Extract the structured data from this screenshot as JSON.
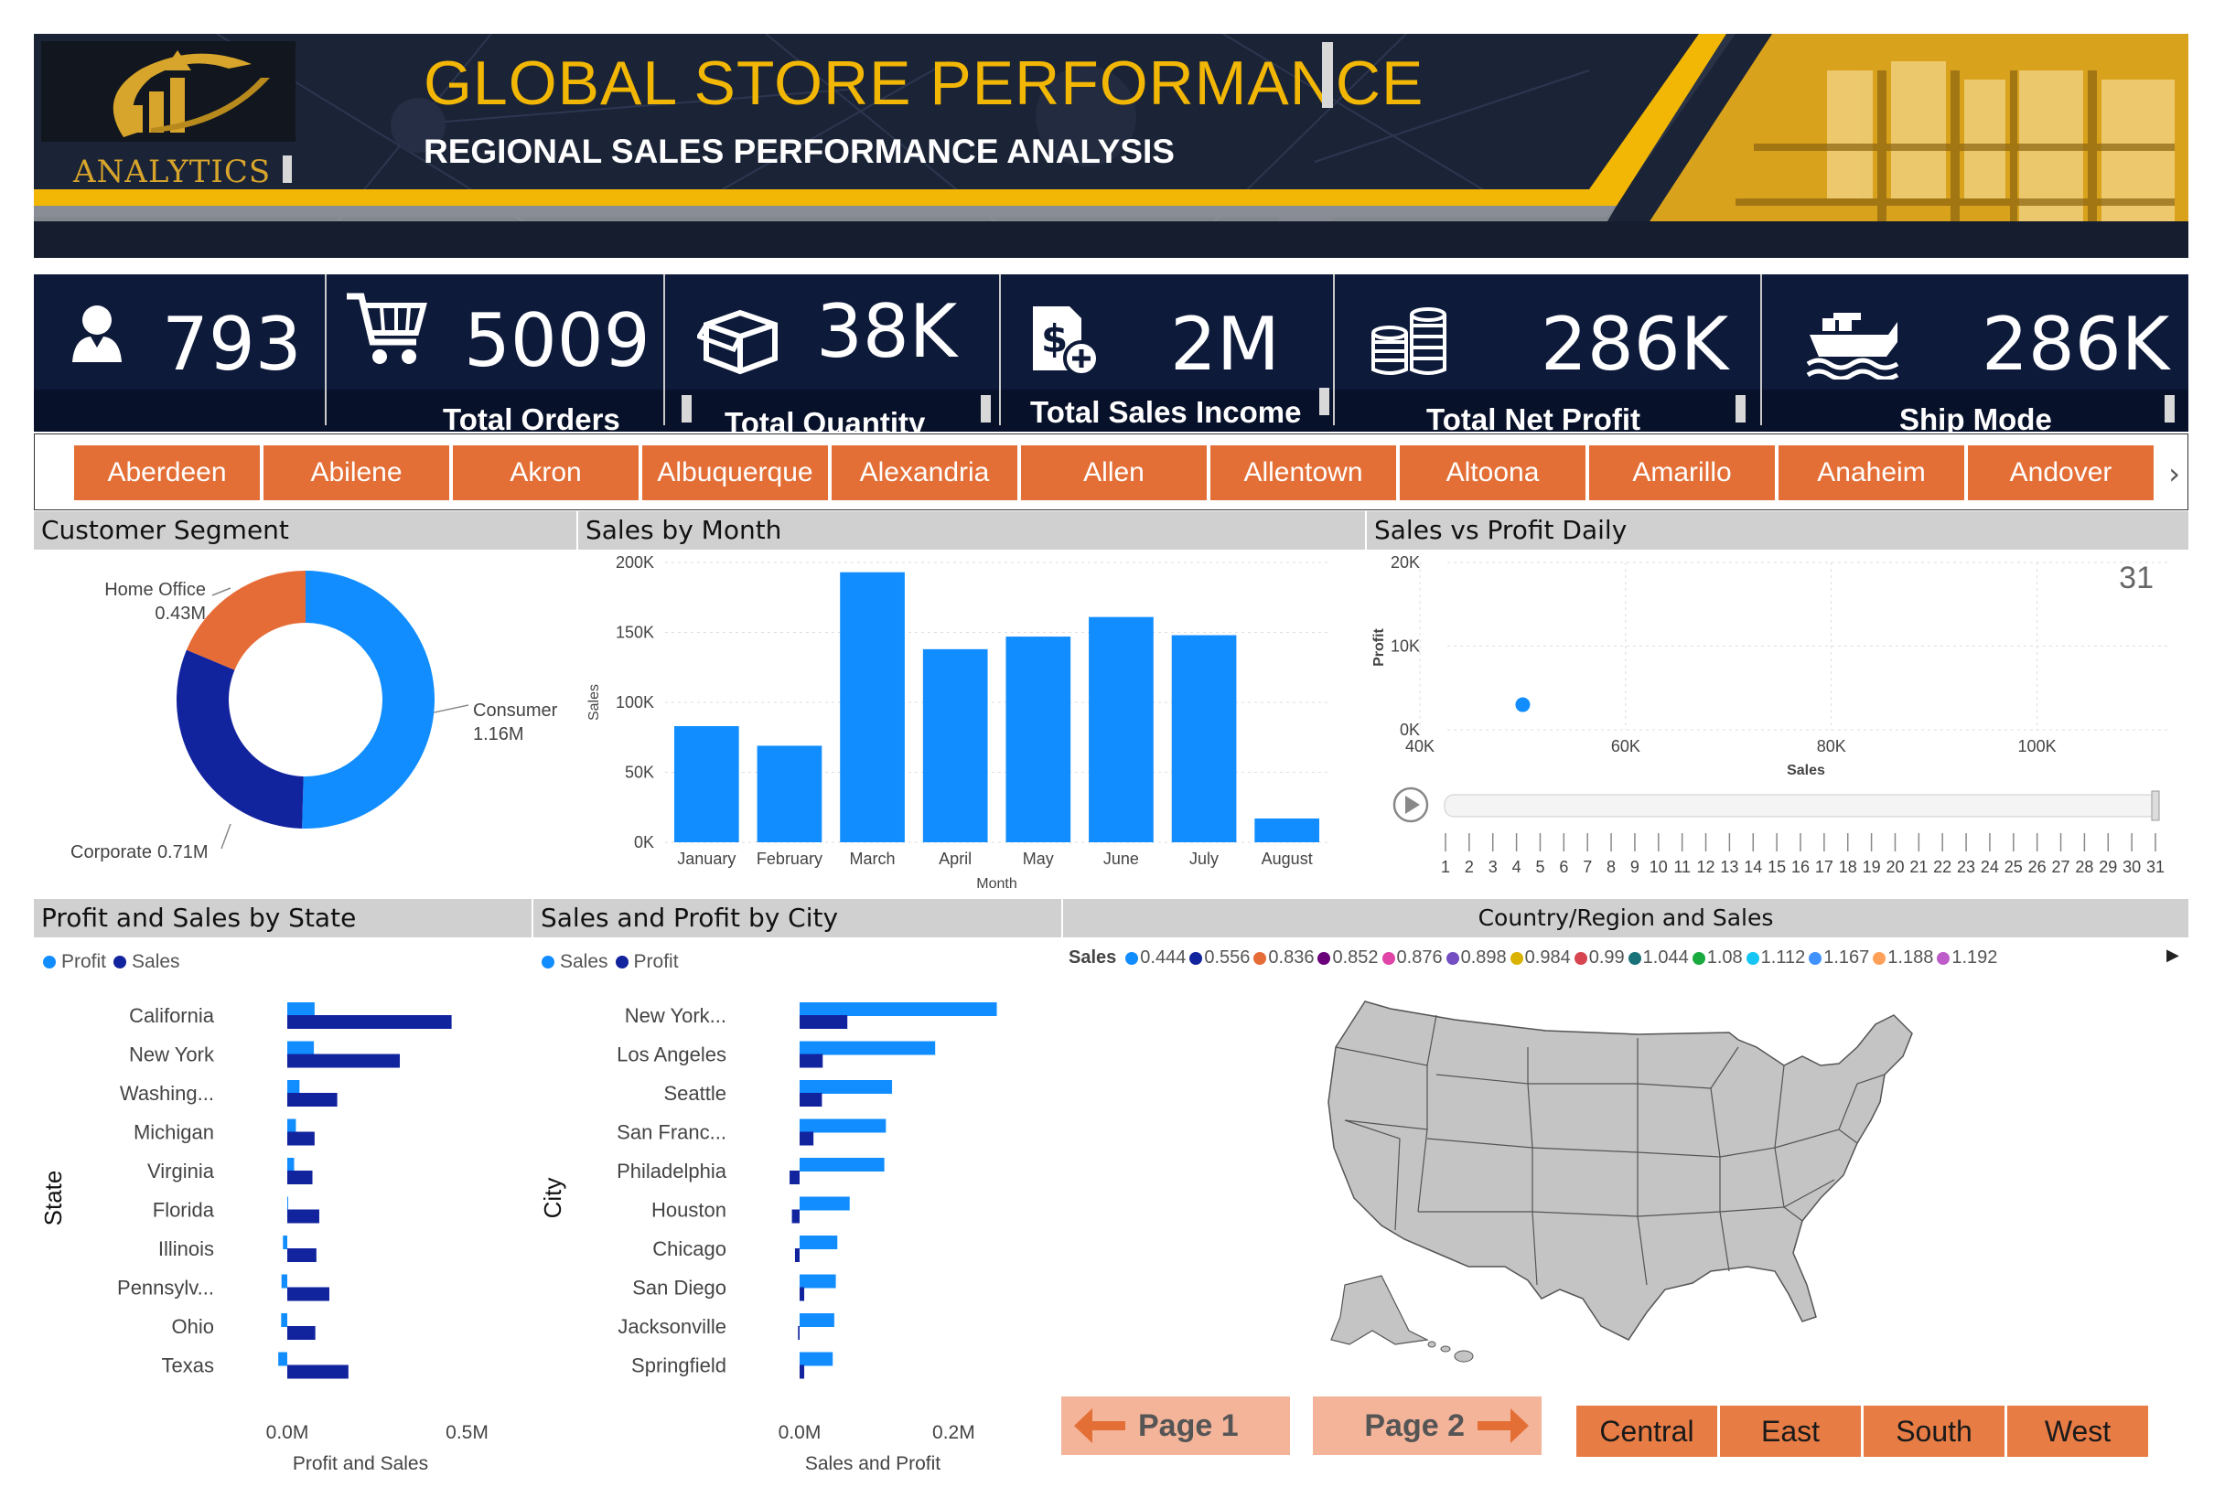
{
  "header": {
    "logo_text": "ANALYTICS",
    "title": "GLOBAL STORE PERFORMANCE",
    "subtitle": "REGIONAL SALES PERFORMANCE ANALYSIS",
    "accent_color": "#f2b705",
    "background_color": "#1b2336"
  },
  "kpis": [
    {
      "icon": "user-icon",
      "value": "793",
      "label": ""
    },
    {
      "icon": "shopping-cart-icon",
      "value": "5009",
      "label": "Total Orders"
    },
    {
      "icon": "box-icon",
      "value": "38K",
      "label": "Total Quantity"
    },
    {
      "icon": "dollar-document-icon",
      "value": "2M",
      "label": "Total Sales Income"
    },
    {
      "icon": "coin-stack-icon",
      "value": "286K",
      "label": "Total Net Profit"
    },
    {
      "icon": "ship-icon",
      "value": "286K",
      "label": "Ship Mode"
    }
  ],
  "city_slicer": {
    "items": [
      "Aberdeen",
      "Abilene",
      "Akron",
      "Albuquerque",
      "Alexandria",
      "Allen",
      "Allentown",
      "Altoona",
      "Amarillo",
      "Anaheim",
      "Andover"
    ],
    "next_icon": "chevron-right-icon",
    "color": "#e46f36"
  },
  "sections": {
    "customer_segment": "Customer Segment",
    "sales_by_month": "Sales by Month",
    "sales_vs_profit": "Sales vs Profit Daily",
    "profit_sales_state": "Profit and Sales by State",
    "sales_profit_city": "Sales and Profit by City",
    "country_region": "Country/Region and Sales"
  },
  "chart_data": [
    {
      "id": "customer_segment",
      "type": "pie",
      "labels": [
        "Consumer",
        "Corporate",
        "Home Office"
      ],
      "values": [
        1.16,
        0.71,
        0.43
      ],
      "value_labels": [
        "1.16M",
        "0.71M",
        "0.43M"
      ],
      "colors": [
        "#118dff",
        "#12239e",
        "#e66c37"
      ]
    },
    {
      "id": "sales_by_month",
      "type": "bar",
      "categories": [
        "January",
        "February",
        "March",
        "April",
        "May",
        "June",
        "July",
        "August"
      ],
      "values": [
        83000,
        69000,
        193000,
        138000,
        147000,
        161000,
        148000,
        17000
      ],
      "xlabel": "Month",
      "ylabel": "Sales",
      "ylim": [
        0,
        200000
      ],
      "yticks": [
        "0K",
        "50K",
        "100K",
        "150K",
        "200K"
      ],
      "color": "#118dff",
      "grid": true
    },
    {
      "id": "sales_vs_profit_daily",
      "type": "scatter",
      "points": [
        {
          "x": 50000,
          "y": 3000
        }
      ],
      "xlabel": "Sales",
      "ylabel": "Profit",
      "xlim": [
        40000,
        110000
      ],
      "ylim": [
        0,
        20000
      ],
      "xticks": [
        "40K",
        "60K",
        "80K",
        "100K"
      ],
      "yticks": [
        "0K",
        "10K",
        "20K"
      ],
      "play_axis_value": "31",
      "play_axis_ticks": [
        "1",
        "2",
        "3",
        "4",
        "5",
        "6",
        "7",
        "8",
        "9",
        "10",
        "11",
        "12",
        "13",
        "14",
        "15",
        "16",
        "17",
        "18",
        "19",
        "20",
        "21",
        "22",
        "23",
        "24",
        "25",
        "26",
        "27",
        "28",
        "29",
        "30",
        "31"
      ],
      "color": "#118dff"
    },
    {
      "id": "profit_sales_by_state",
      "type": "bar",
      "orientation": "horizontal",
      "categories": [
        "California",
        "New York",
        "Washing...",
        "Michigan",
        "Virginia",
        "Florida",
        "Illinois",
        "Pennsylv...",
        "Ohio",
        "Texas"
      ],
      "series": [
        {
          "name": "Profit",
          "values": [
            0.076,
            0.074,
            0.034,
            0.024,
            0.019,
            0.0,
            -0.012,
            -0.016,
            -0.017,
            -0.025
          ],
          "color": "#118dff"
        },
        {
          "name": "Sales",
          "values": [
            0.457,
            0.313,
            0.139,
            0.076,
            0.07,
            0.089,
            0.081,
            0.117,
            0.078,
            0.17
          ],
          "color": "#12239e"
        }
      ],
      "xlabel": "Profit and Sales",
      "ylabel": "State",
      "xticks": [
        "0.0M",
        "0.5M"
      ]
    },
    {
      "id": "sales_profit_by_city",
      "type": "bar",
      "orientation": "horizontal",
      "categories": [
        "New York...",
        "Los Angeles",
        "Seattle",
        "San Franc...",
        "Philadelphia",
        "Houston",
        "Chicago",
        "San Diego",
        "Jacksonville",
        "Springfield"
      ],
      "series": [
        {
          "name": "Sales",
          "values": [
            0.256,
            0.176,
            0.12,
            0.112,
            0.11,
            0.065,
            0.049,
            0.047,
            0.045,
            0.043
          ],
          "color": "#118dff"
        },
        {
          "name": "Profit",
          "values": [
            0.062,
            0.03,
            0.029,
            0.018,
            -0.013,
            -0.01,
            -0.006,
            0.006,
            -0.002,
            0.006
          ],
          "color": "#12239e"
        }
      ],
      "xlabel": "Sales and Profit",
      "ylabel": "City",
      "xticks": [
        "0.0M",
        "0.2M"
      ]
    }
  ],
  "map": {
    "legend_title": "Sales",
    "legend_items": [
      {
        "label": "0.444",
        "color": "#118dff"
      },
      {
        "label": "0.556",
        "color": "#12239e"
      },
      {
        "label": "0.836",
        "color": "#e66c37"
      },
      {
        "label": "0.852",
        "color": "#6b007b"
      },
      {
        "label": "0.876",
        "color": "#e044a7"
      },
      {
        "label": "0.898",
        "color": "#744ec2"
      },
      {
        "label": "0.984",
        "color": "#d9b300"
      },
      {
        "label": "0.99",
        "color": "#d64550"
      },
      {
        "label": "1.044",
        "color": "#197278"
      },
      {
        "label": "1.08",
        "color": "#1aab40"
      },
      {
        "label": "1.112",
        "color": "#15c6f4"
      },
      {
        "label": "1.167",
        "color": "#4092ff"
      },
      {
        "label": "1.188",
        "color": "#ffa058"
      },
      {
        "label": "1.192",
        "color": "#be5dc9"
      }
    ],
    "land_color": "#c4c4c4"
  },
  "navigation": {
    "page1": "Page 1",
    "page2": "Page 2"
  },
  "regions": [
    "Central",
    "East",
    "South",
    "West"
  ]
}
